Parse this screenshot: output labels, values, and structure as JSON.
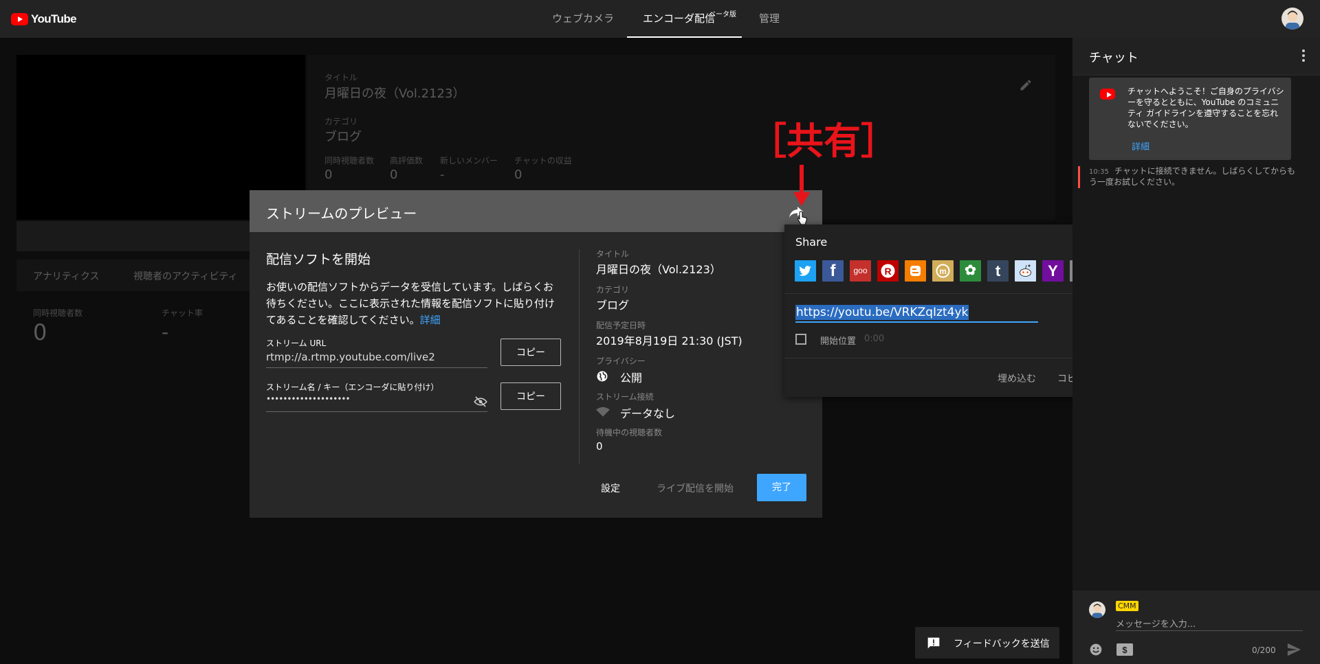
{
  "header": {
    "logo_text": "YouTube",
    "tabs": [
      {
        "label": "ウェブカメラ"
      },
      {
        "label": "エンコーダ配信"
      },
      {
        "label": "管理"
      }
    ],
    "beta_badge": "ベータ版"
  },
  "background": {
    "title_label": "タイトル",
    "title_value": "月曜日の夜（Vol.2123）",
    "category_label": "カテゴリ",
    "category_value": "ブログ",
    "stats": [
      {
        "label": "同時視聴者数",
        "value": "0"
      },
      {
        "label": "高評価数",
        "value": "0"
      },
      {
        "label": "新しいメンバー",
        "value": "-"
      },
      {
        "label": "チャットの収益",
        "value": "0"
      }
    ],
    "tabs": [
      {
        "label": "アナリティクス"
      },
      {
        "label": "視聴者のアクティビティ"
      }
    ],
    "analytics": [
      {
        "label": "同時視聴者数",
        "value": "0"
      },
      {
        "label": "チャット率",
        "value": "-"
      }
    ]
  },
  "modal": {
    "title": "ストリームのプレビュー",
    "section_title": "配信ソフトを開始",
    "description": "お使いの配信ソフトからデータを受信しています。しばらくお待ちください。ここに表示された情報を配信ソフトに貼り付けてあることを確認してください。",
    "details_link": "詳細",
    "stream_url_label": "ストリーム URL",
    "stream_url_value": "rtmp://a.rtmp.youtube.com/live2",
    "stream_key_label": "ストリーム名 / キー（エンコーダに貼り付け）",
    "stream_key_value": "••••••••••••••••••••",
    "copy_label": "コピー",
    "info": {
      "title_label": "タイトル",
      "title_value": "月曜日の夜（Vol.2123）",
      "category_label": "カテゴリ",
      "category_value": "ブログ",
      "schedule_label": "配信予定日時",
      "schedule_value": "2019年8月19日 21:30 (JST)",
      "privacy_label": "プライバシー",
      "privacy_value": "公開",
      "connection_label": "ストリーム接続",
      "connection_value": "データなし",
      "waiting_label": "待機中の視聴者数",
      "waiting_value": "0"
    },
    "buttons": {
      "settings": "設定",
      "go_live": "ライブ配信を開始",
      "done": "完了"
    }
  },
  "share": {
    "title": "Share",
    "services": [
      {
        "name": "twitter",
        "glyph": "",
        "color": "#1da1f2"
      },
      {
        "name": "facebook",
        "glyph": "f",
        "color": "#3b5998"
      },
      {
        "name": "goo",
        "glyph": "goo",
        "color": "#c4302b"
      },
      {
        "name": "rakuten",
        "glyph": "R",
        "color": "#bf0000"
      },
      {
        "name": "blogger",
        "glyph": "B",
        "color": "#f57d00"
      },
      {
        "name": "mixi",
        "glyph": "m",
        "color": "#d1ad59"
      },
      {
        "name": "ameba",
        "glyph": "✿",
        "color": "#2d8c3c"
      },
      {
        "name": "tumblr",
        "glyph": "t",
        "color": "#35465c"
      },
      {
        "name": "reddit",
        "glyph": "",
        "color": "#cee3f8"
      },
      {
        "name": "yahoo",
        "glyph": "Y",
        "color": "#720e9e"
      },
      {
        "name": "email",
        "glyph": "✉",
        "color": "#888888"
      }
    ],
    "url": "https://youtu.be/VRKZqIzt4yk",
    "start_label": "開始位置",
    "start_value": "0:00",
    "embed": "埋め込む",
    "copy": "コピー"
  },
  "chat": {
    "title": "チャット",
    "welcome": "チャットへようこそ！ご自身のプライバシーを守るとともに、YouTube のコミュニティ ガイドラインを遵守することを忘れないでください。",
    "welcome_link": "詳細",
    "error_time": "10:35",
    "error_text": "チャットに接続できません。しばらくしてからもう一度お試しください。",
    "user_badge": "CMM",
    "input_placeholder": "メッセージを入力...",
    "counter": "0/200"
  },
  "feedback": "フィードバックを送信",
  "annotation": "［共有］"
}
